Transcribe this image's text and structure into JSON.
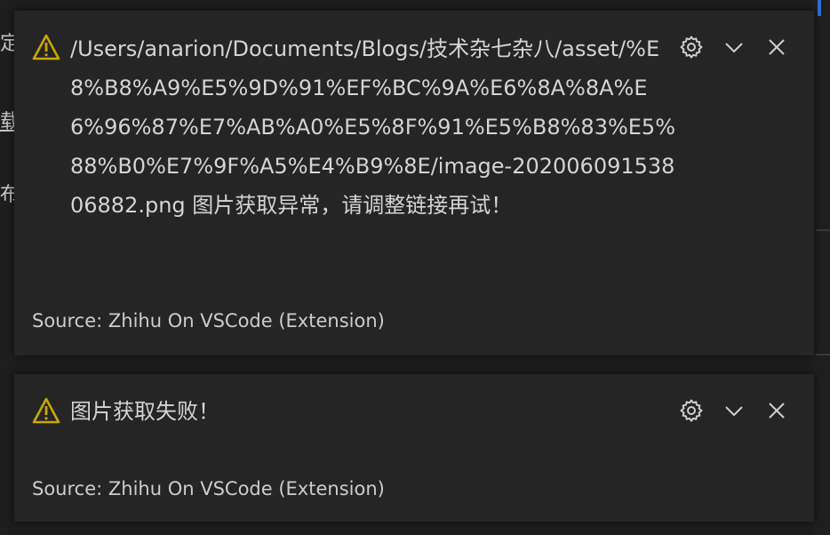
{
  "editor_background": {
    "glyphs": [
      "定",
      "载/",
      "布"
    ]
  },
  "notifications": [
    {
      "severity": "warning",
      "message": "/Users/anarion/Documents/Blogs/技术杂七杂八/asset/%E8%B8%A9%E5%9D%91%EF%BC%9A%E6%8A%8A%E6%96%87%E7%AB%A0%E5%8F%91%E5%B8%83%E5%88%B0%E7%9F%A5%E4%B9%8E/image-20200609153806882.png 图片获取异常，请调整链接再试！",
      "source": "Source: Zhihu On VSCode (Extension)"
    },
    {
      "severity": "warning",
      "message": "图片获取失败！",
      "source": "Source: Zhihu On VSCode (Extension)"
    }
  ],
  "icons": {
    "warning": "warning-icon",
    "settings": "gear-icon",
    "collapse": "chevron-down-icon",
    "close": "close-icon"
  },
  "colors": {
    "warning_icon": "#cca700",
    "toast_bg": "#252526",
    "text": "#d4d4d4",
    "accent": "#2f6fd6"
  }
}
